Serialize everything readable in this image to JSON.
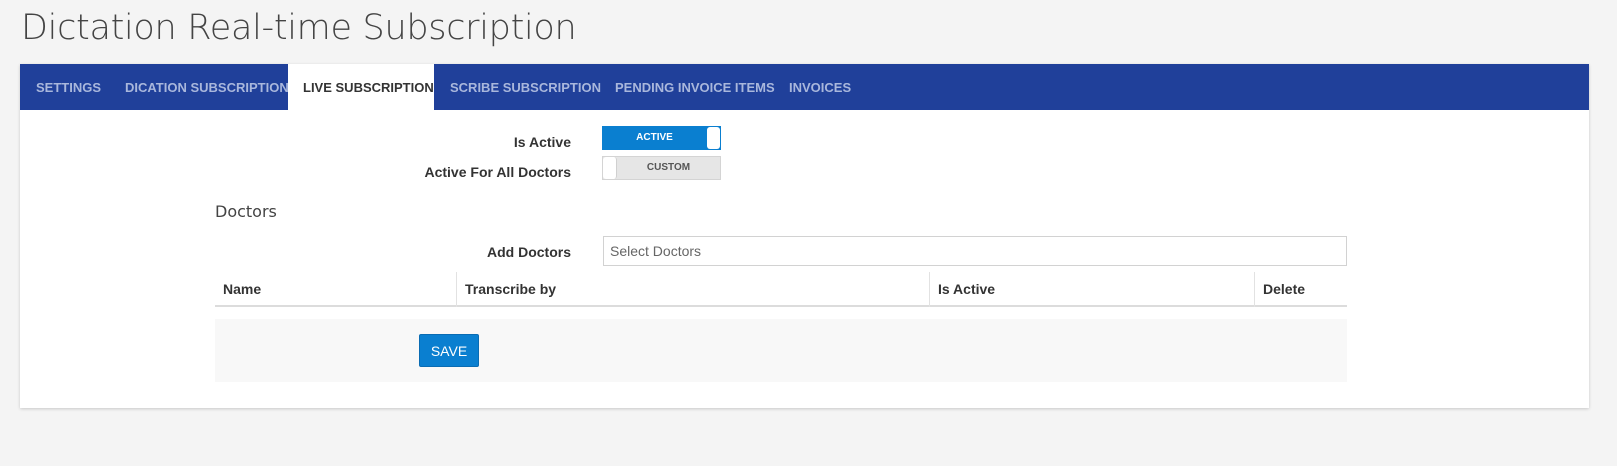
{
  "page": {
    "title": "Dictation Real-time Subscription"
  },
  "tabs": [
    {
      "label": "SETTINGS",
      "active": false
    },
    {
      "label": "DICATION SUBSCRIPTION",
      "active": false
    },
    {
      "label": "LIVE SUBSCRIPTION",
      "active": true
    },
    {
      "label": "SCRIBE SUBSCRIPTION",
      "active": false
    },
    {
      "label": "PENDING INVOICE ITEMS",
      "active": false
    },
    {
      "label": "INVOICES",
      "active": false
    }
  ],
  "form": {
    "is_active": {
      "label": "Is Active",
      "toggle_text": "ACTIVE",
      "state": true
    },
    "active_for_all": {
      "label": "Active For All Doctors",
      "toggle_text": "CUSTOM",
      "state": false
    }
  },
  "doctors": {
    "section_title": "Doctors",
    "add_label": "Add Doctors",
    "select_placeholder": "Select Doctors",
    "columns": [
      "Name",
      "Transcribe by",
      "Is Active",
      "Delete"
    ],
    "rows": []
  },
  "actions": {
    "save_label": "SAVE"
  },
  "colors": {
    "tabbar": "#20409a",
    "accent": "#0a7fd0",
    "background": "#f4f4f4"
  }
}
